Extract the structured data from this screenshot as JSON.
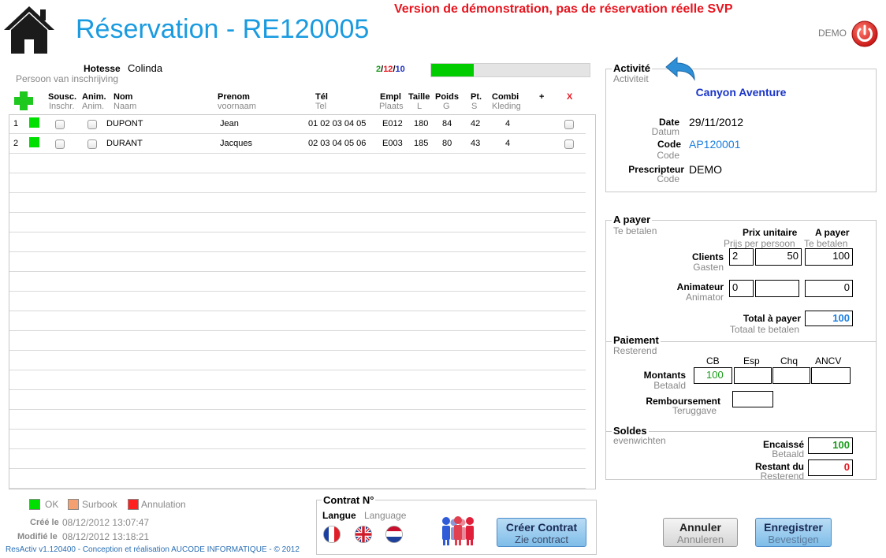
{
  "header": {
    "title": "Réservation - RE120005",
    "demo_warning": "Version de démonstration, pas de réservation réelle SVP",
    "demo_label": "DEMO"
  },
  "colors": {
    "accent": "#1a9be0",
    "warning": "#e8141e",
    "ok": "#00e000",
    "surbook": "#f4a070",
    "annulation": "#ff2020"
  },
  "hotesse": {
    "label": "Hotesse",
    "value": "Colinda",
    "sublabel": "Persoon van inschrijving"
  },
  "counts": {
    "a": "2",
    "b": "12",
    "c": "10",
    "sep": "/"
  },
  "progress": {
    "fraction": 0.27
  },
  "table": {
    "columns": [
      {
        "key": "sousc",
        "label": "Sousc.",
        "sub": "Inschr."
      },
      {
        "key": "anim",
        "label": "Anim.",
        "sub": "Anim."
      },
      {
        "key": "nom",
        "label": "Nom",
        "sub": "Naam"
      },
      {
        "key": "prenom",
        "label": "Prenom",
        "sub": "voornaam"
      },
      {
        "key": "tel",
        "label": "Tél",
        "sub": "Tel"
      },
      {
        "key": "empl",
        "label": "Empl",
        "sub": "Plaats"
      },
      {
        "key": "taille",
        "label": "Taille",
        "sub": "L"
      },
      {
        "key": "poids",
        "label": "Poids",
        "sub": "G"
      },
      {
        "key": "pt",
        "label": "Pt.",
        "sub": "S"
      },
      {
        "key": "combi",
        "label": "Combi",
        "sub": "Kleding"
      },
      {
        "key": "plus",
        "label": "+",
        "sub": ""
      },
      {
        "key": "x",
        "label": "X",
        "sub": ""
      }
    ],
    "rows": [
      {
        "num": "1",
        "nom": "DUPONT",
        "prenom": "Jean",
        "tel": "01 02 03 04 05",
        "empl": "E012",
        "taille": "180",
        "poids": "84",
        "pt": "42",
        "combi": "4"
      },
      {
        "num": "2",
        "nom": "DURANT",
        "prenom": "Jacques",
        "tel": "02 03 04 05 06",
        "empl": "E003",
        "taille": "185",
        "poids": "80",
        "pt": "43",
        "combi": "4"
      }
    ]
  },
  "legend": {
    "ok": "OK",
    "surbook": "Surbook",
    "annulation": "Annulation"
  },
  "meta": {
    "cree_label": "Créé le",
    "cree_value": "08/12/2012 13:07:47",
    "modifie_label": "Modifié le",
    "modifie_value": "08/12/2012 13:18:21",
    "footer": "ResActiv v1.120400 - Conception et réalisation AUCODE INFORMATIQUE - © 2012"
  },
  "contrat": {
    "title": "Contrat N°",
    "langue_label": "Langue",
    "langue_sub": "Language",
    "create_label": "Créer Contrat",
    "create_sub": "Zie contract"
  },
  "activite": {
    "title": "Activité",
    "sub": "Activiteit",
    "name": "Canyon Aventure",
    "date_label": "Date",
    "date_sub": "Datum",
    "date_value": "29/11/2012",
    "code_label": "Code",
    "code_sub": "Code",
    "code_value": "AP120001",
    "prescripteur_label": "Prescripteur",
    "prescripteur_sub": "Code",
    "prescripteur_value": "DEMO"
  },
  "apayer": {
    "title": "A payer",
    "sub": "Te betalen",
    "prix_label": "Prix unitaire",
    "prix_sub": "Prijs per persoon",
    "total_col_label": "A payer",
    "total_col_sub": "Te betalen",
    "clients_label": "Clients",
    "clients_sub": "Gasten",
    "clients_qty": "2",
    "clients_prix": "50",
    "clients_total": "100",
    "anim_label": "Animateur",
    "anim_sub": "Animator",
    "anim_qty": "0",
    "anim_prix": "",
    "anim_total": "0",
    "total_label": "Total à payer",
    "total_sub": "Totaal te betalen",
    "total_value": "100"
  },
  "paiement": {
    "title": "Paiement",
    "sub": "Resterend",
    "cb": "CB",
    "esp": "Esp",
    "chq": "Chq",
    "ancv": "ANCV",
    "montants_label": "Montants",
    "montants_sub": "Betaald",
    "cb_value": "100",
    "esp_value": "",
    "chq_value": "",
    "ancv_value": "",
    "remb_label": "Remboursement",
    "remb_sub": "Teruggave",
    "remb_value": ""
  },
  "soldes": {
    "title": "Soldes",
    "sub": "evenwichten",
    "encaisse_label": "Encaissé",
    "encaisse_sub": "Betaald",
    "encaisse_value": "100",
    "restant_label": "Restant du",
    "restant_sub": "Resterend",
    "restant_value": "0"
  },
  "buttons": {
    "annuler": "Annuler",
    "annuler_sub": "Annuleren",
    "enregistrer": "Enregistrer",
    "enregistrer_sub": "Bevestigen"
  }
}
